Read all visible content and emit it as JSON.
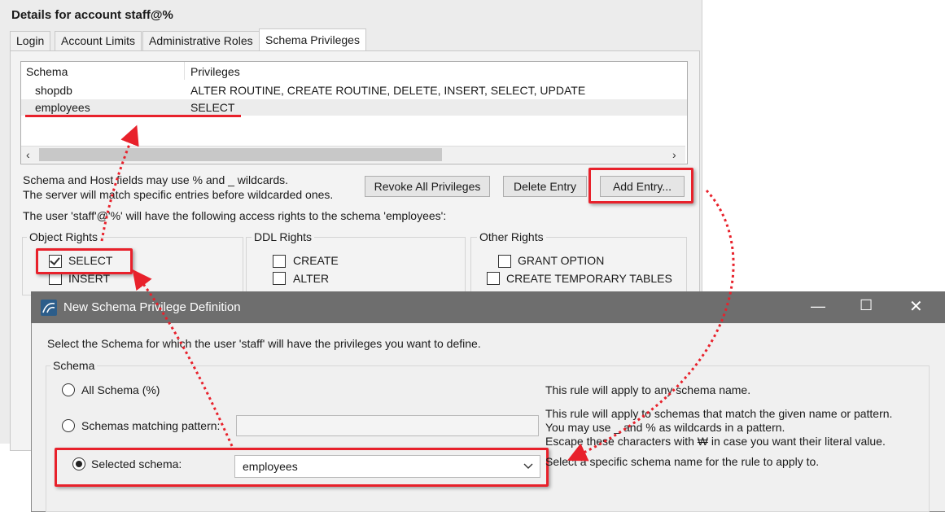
{
  "main": {
    "title": "Details for account staff@%",
    "tabs": [
      "Login",
      "Account Limits",
      "Administrative Roles",
      "Schema Privileges"
    ],
    "columns": [
      "Schema",
      "Privileges"
    ],
    "rows": [
      {
        "schema": "shopdb",
        "privileges": "ALTER ROUTINE, CREATE ROUTINE, DELETE, INSERT, SELECT, UPDATE"
      },
      {
        "schema": "employees",
        "privileges": "SELECT"
      }
    ],
    "hint_line1": "Schema and Host fields may use % and _ wildcards.",
    "hint_line2": "The server will match specific entries before wildcarded ones.",
    "revoke_label": "Revoke All Privileges",
    "delete_label": "Delete Entry",
    "add_label": "Add Entry...",
    "access_text": "The user 'staff'@'%' will have the following access rights to the schema 'employees':",
    "object_rights": {
      "title": "Object Rights",
      "items": [
        "SELECT",
        "INSERT"
      ]
    },
    "ddl_rights": {
      "title": "DDL Rights",
      "items": [
        "CREATE",
        "ALTER"
      ]
    },
    "other_rights": {
      "title": "Other Rights",
      "items": [
        "GRANT OPTION",
        "CREATE TEMPORARY TABLES"
      ]
    }
  },
  "dialog": {
    "title": "New Schema Privilege Definition",
    "instruction": "Select the Schema for which the user 'staff' will have the privileges you want to define.",
    "group_label": "Schema",
    "opt_all": "All Schema (%)",
    "opt_pattern": "Schemas matching pattern:",
    "opt_selected": "Selected schema:",
    "selected_value": "employees",
    "desc_all": "This rule will apply to any schema name.",
    "desc_pattern_1": "This rule will apply to schemas that match the given name or pattern.",
    "desc_pattern_2": "You may use _ and % as wildcards in a pattern.",
    "desc_pattern_3": "Escape these characters with ₩ in case you want their literal value.",
    "desc_selected": "Select a specific schema name for the rule to apply to."
  },
  "colors": {
    "annotation": "#e8212b"
  }
}
